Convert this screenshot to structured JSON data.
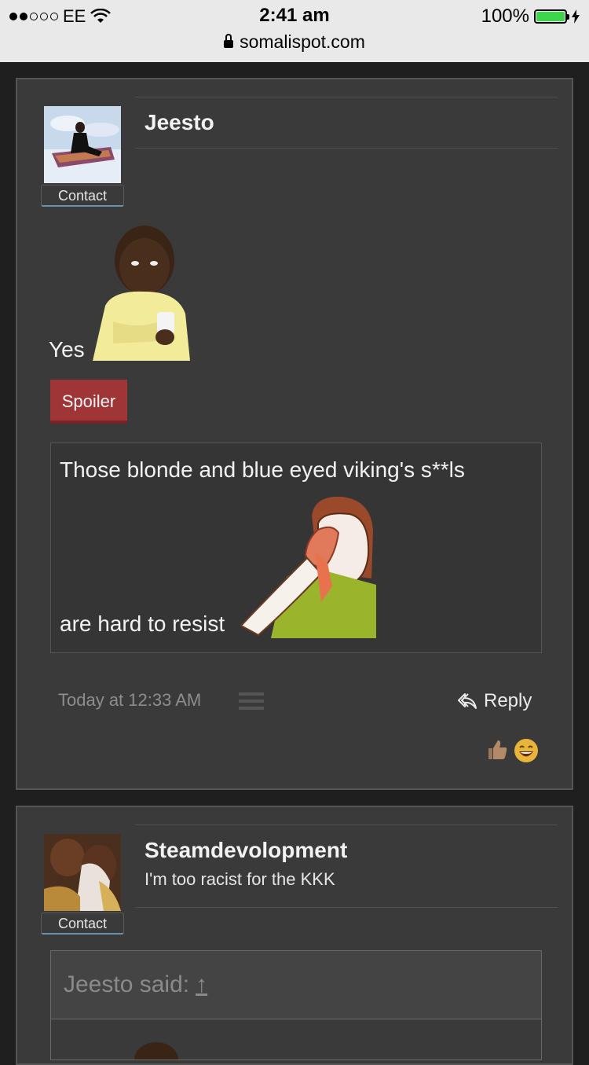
{
  "status_bar": {
    "carrier": "EE",
    "time": "2:41 am",
    "battery": "100%",
    "url": "somalispot.com"
  },
  "posts": [
    {
      "username": "Jeesto",
      "contact_label": "Contact",
      "body_text": "Yes",
      "spoiler_label": "Spoiler",
      "spoiler_line1": "Those blonde and blue eyed viking's s**ls",
      "spoiler_line2": "are hard to resist",
      "timestamp": "Today at 12:33 AM",
      "reply_label": "Reply"
    },
    {
      "username": "Steamdevolopment",
      "user_title": "I'm too racist for the KKK",
      "contact_label": "Contact",
      "quote_label": "Jeesto said:",
      "quote_arrow": "↑"
    }
  ],
  "colors": {
    "page_bg": "#1f1f1f",
    "post_bg": "#3a3a3a",
    "spoiler_red": "#a03538",
    "battery_green": "#3bd64a"
  }
}
